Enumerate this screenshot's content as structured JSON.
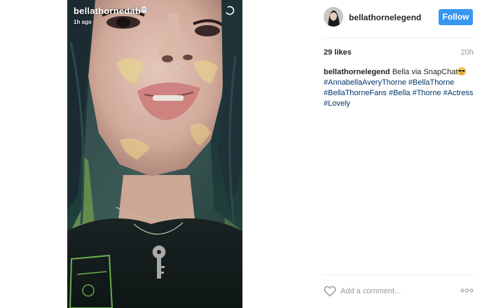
{
  "media": {
    "snap_username": "bellathornedab",
    "snap_time": "1h ago",
    "emoji_icon": "ghost-emoji-icon",
    "timer_icon": "snap-timer-icon"
  },
  "header": {
    "avatar_icon": "profile-avatar",
    "username": "bellathornelegend",
    "follow_label": "Follow"
  },
  "stats": {
    "likes": "29 likes",
    "time": "20h"
  },
  "caption": {
    "username": "bellathornelegend",
    "text": "Bella via SnapChat",
    "emoji_icon": "sunglasses-face-icon",
    "hashtags": [
      "#AnnabellaAveryThorne",
      "#BellaThorne",
      "#BellaThorneFans",
      "#Bella",
      "#Thorne",
      "#Actress",
      "#Lovely"
    ]
  },
  "comment": {
    "placeholder": "Add a comment...",
    "heart_icon": "heart-outline-icon",
    "more_icon": "more-options-icon"
  },
  "colors": {
    "follow_button": "#3897f0",
    "hashtag": "#003569",
    "text": "#262626",
    "muted": "#999999",
    "divider": "#efefef"
  }
}
